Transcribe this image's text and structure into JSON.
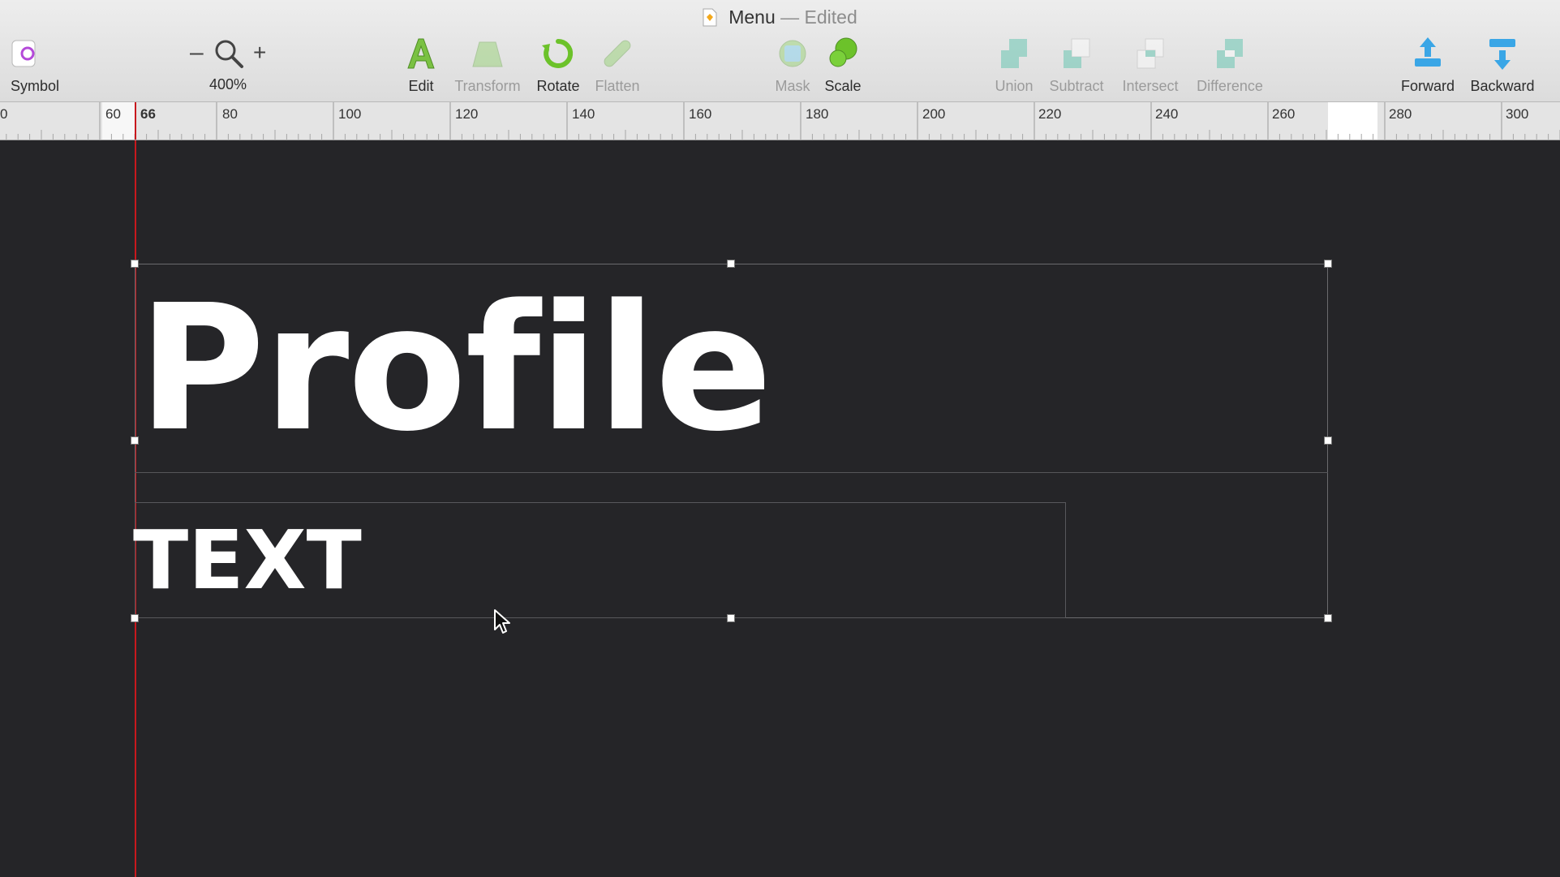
{
  "window": {
    "title": "Menu",
    "title_separator": " — ",
    "title_status": "Edited"
  },
  "toolbar": {
    "symbol_label": "Symbol",
    "zoom": {
      "minus": "–",
      "plus": "+",
      "level": "400%"
    },
    "edit_label": "Edit",
    "transform_label": "Transform",
    "rotate_label": "Rotate",
    "flatten_label": "Flatten",
    "mask_label": "Mask",
    "scale_label": "Scale",
    "union_label": "Union",
    "subtract_label": "Subtract",
    "intersect_label": "Intersect",
    "difference_label": "Difference",
    "forward_label": "Forward",
    "backward_label": "Backward"
  },
  "ruler": {
    "labels": [
      "0",
      "60",
      "66",
      "80",
      "100",
      "120",
      "140",
      "160",
      "180",
      "200",
      "220",
      "240",
      "260",
      "280",
      "300"
    ]
  },
  "canvas": {
    "heading_text": "Profile",
    "body_text": "TEXT"
  },
  "colors": {
    "canvas_background": "#252528",
    "guide": "#c8181d",
    "toolbar_background": "#e4e4e4",
    "accent_green": "#6cc22a",
    "accent_blue": "#3aa6e6",
    "accent_teal": "#6fd3c0"
  },
  "icons": {
    "symbol": "symbol-icon",
    "zoom": "magnifier-icon",
    "edit": "edit-a-icon",
    "transform": "transform-icon",
    "rotate": "rotate-icon",
    "flatten": "flatten-icon",
    "mask": "mask-icon",
    "scale": "scale-icon",
    "union": "union-icon",
    "subtract": "subtract-icon",
    "intersect": "intersect-icon",
    "difference": "difference-icon",
    "forward": "forward-icon",
    "backward": "backward-icon",
    "cursor": "mouse-pointer-icon"
  }
}
